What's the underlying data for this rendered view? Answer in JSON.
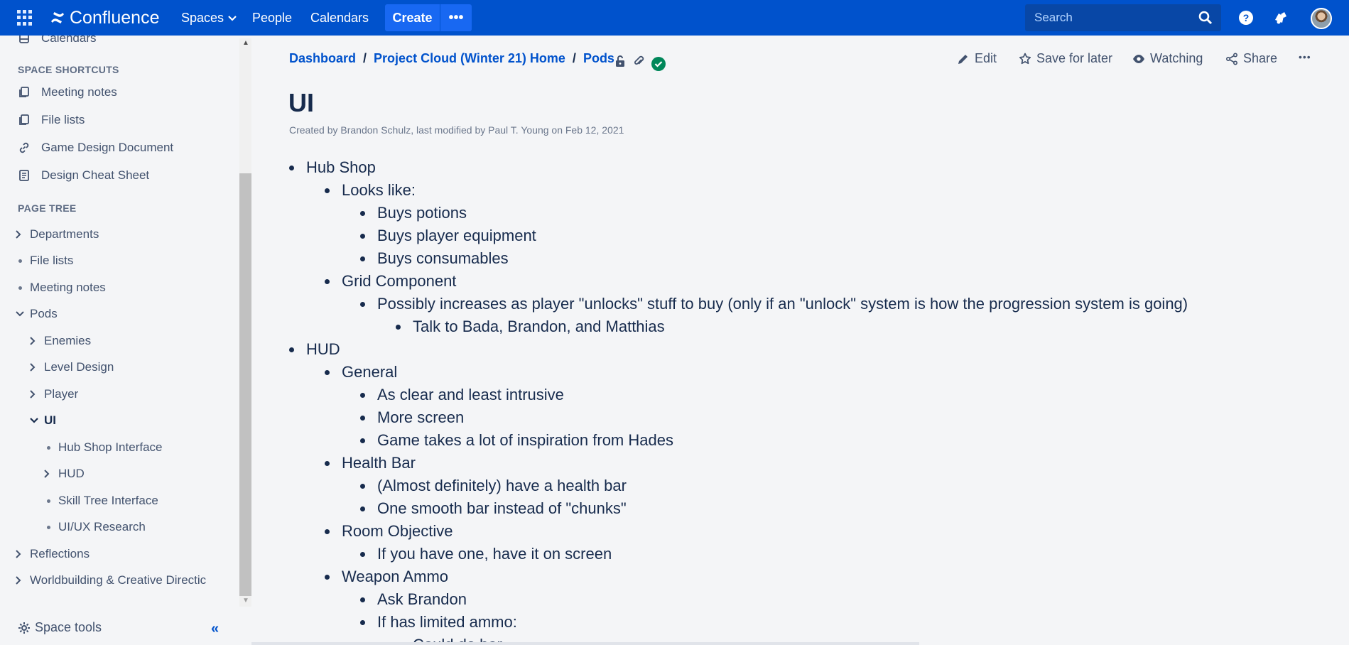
{
  "topbar": {
    "brand": "Confluence",
    "nav": [
      "Spaces",
      "People",
      "Calendars"
    ],
    "create_label": "Create",
    "more_label": "•••",
    "search_placeholder": "Search",
    "colors": {
      "bar": "#0052cc",
      "create": "#1868f2",
      "search_bg": "#0847a6"
    }
  },
  "sidebar": {
    "partial_item": "Calendars",
    "shortcuts_heading": "SPACE SHORTCUTS",
    "shortcuts": [
      "Meeting notes",
      "File lists",
      "Game Design Document",
      "Design Cheat Sheet"
    ],
    "tree_heading": "PAGE TREE",
    "tree": [
      {
        "label": "Departments",
        "marker": "chevron-right"
      },
      {
        "label": "File lists",
        "marker": "dot"
      },
      {
        "label": "Meeting notes",
        "marker": "dot"
      },
      {
        "label": "Pods",
        "marker": "chevron-down"
      },
      {
        "label": "Enemies",
        "marker": "chevron-right"
      },
      {
        "label": "Level Design",
        "marker": "chevron-right"
      },
      {
        "label": "Player",
        "marker": "chevron-right"
      },
      {
        "label": "UI",
        "marker": "chevron-down",
        "active": true
      },
      {
        "label": "Hub Shop Interface",
        "marker": "dot"
      },
      {
        "label": "HUD",
        "marker": "chevron-right"
      },
      {
        "label": "Skill Tree Interface",
        "marker": "dot"
      },
      {
        "label": "UI/UX Research",
        "marker": "dot"
      },
      {
        "label": "Reflections",
        "marker": "chevron-right"
      },
      {
        "label": "Worldbuilding & Creative Directic",
        "marker": "chevron-right"
      }
    ],
    "space_tools": "Space tools"
  },
  "breadcrumb": [
    "Dashboard",
    "Project Cloud (Winter 21) Home",
    "Pods"
  ],
  "actions": {
    "edit": "Edit",
    "save": "Save for later",
    "watch": "Watching",
    "share": "Share",
    "more": "•••"
  },
  "page": {
    "title": "UI",
    "byline": "Created by Brandon Schulz, last modified by Paul T. Young on Feb 12, 2021"
  },
  "content": [
    "Hub Shop",
    "Looks like:",
    "Buys potions",
    "Buys player equipment",
    "Buys consumables",
    "Grid Component",
    "Possibly increases as player \"unlocks\" stuff to buy (only if an \"unlock\" system is how the progression system is going)",
    "Talk to Bada, Brandon, and Matthias",
    "HUD",
    "General",
    "As clear and least intrusive",
    "More screen",
    "Game takes a lot of inspiration from Hades",
    "Health Bar",
    "(Almost definitely) have a health bar",
    "One smooth bar instead of \"chunks\"",
    "Room Objective",
    "If you have one, have it on screen",
    "Weapon Ammo",
    "Ask Brandon",
    "If has limited ammo:",
    "Could do bar"
  ]
}
